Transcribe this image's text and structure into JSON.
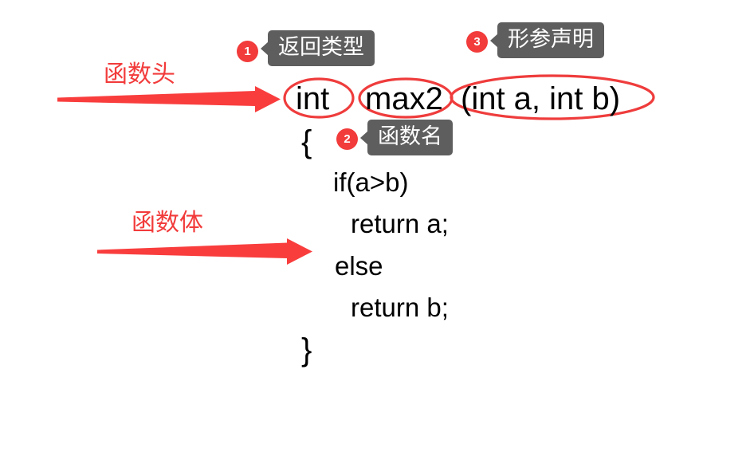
{
  "figure": {
    "title": "C function anatomy annotated diagram",
    "background_color": "#ffffff",
    "accent_red": "#f23b3b",
    "callout_gray": "#5e5e5e",
    "code_color": "#000000"
  },
  "code": {
    "signature": {
      "return_type": "int",
      "function_name": "max2",
      "parameter_list": "(int a, int b)"
    },
    "lines": [
      {
        "text": "{",
        "kind": "brace"
      },
      {
        "text": "if(a>b)",
        "kind": "body"
      },
      {
        "text": "return a;",
        "kind": "body"
      },
      {
        "text": "else",
        "kind": "body"
      },
      {
        "text": "return b;",
        "kind": "body"
      },
      {
        "text": "}",
        "kind": "brace"
      }
    ]
  },
  "side_labels": [
    {
      "text": "函数头",
      "meaning": "function-header"
    },
    {
      "text": "函数体",
      "meaning": "function-body"
    }
  ],
  "callouts": [
    {
      "number": "1",
      "label": "返回类型",
      "target": "return-type"
    },
    {
      "number": "2",
      "label": "函数名",
      "target": "function-name"
    },
    {
      "number": "3",
      "label": "形参声明",
      "target": "parameter-declaration"
    }
  ],
  "annotations": {
    "ellipses": [
      {
        "name": "return-type-ellipse"
      },
      {
        "name": "function-name-ellipse"
      },
      {
        "name": "parameter-list-ellipse"
      }
    ],
    "arrows": [
      {
        "name": "function-header-arrow"
      },
      {
        "name": "function-body-arrow"
      }
    ]
  }
}
